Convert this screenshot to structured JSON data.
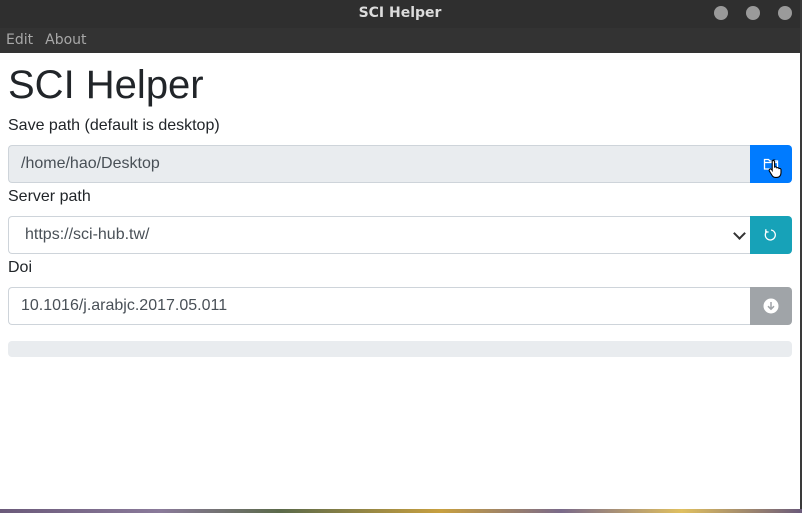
{
  "window": {
    "title": "SCI Helper"
  },
  "menu": {
    "items": [
      "Edit",
      "About"
    ]
  },
  "app": {
    "heading": "SCI Helper"
  },
  "save_path": {
    "label": "Save path (default is desktop)",
    "value": "/home/hao/Desktop",
    "button_icon": "folder-icon"
  },
  "server_path": {
    "label": "Server path",
    "selected": "https://sci-hub.tw/",
    "button_icon": "refresh-icon"
  },
  "doi": {
    "label": "Doi",
    "value": "10.1016/j.arabjc.2017.05.011",
    "button_icon": "download-icon"
  },
  "progress": {
    "value": 0
  },
  "colors": {
    "primary": "#007bff",
    "info": "#17a2b8",
    "secondary": "#a0a4a8",
    "titlebar": "#2f2f2f",
    "menubar": "#333333"
  }
}
